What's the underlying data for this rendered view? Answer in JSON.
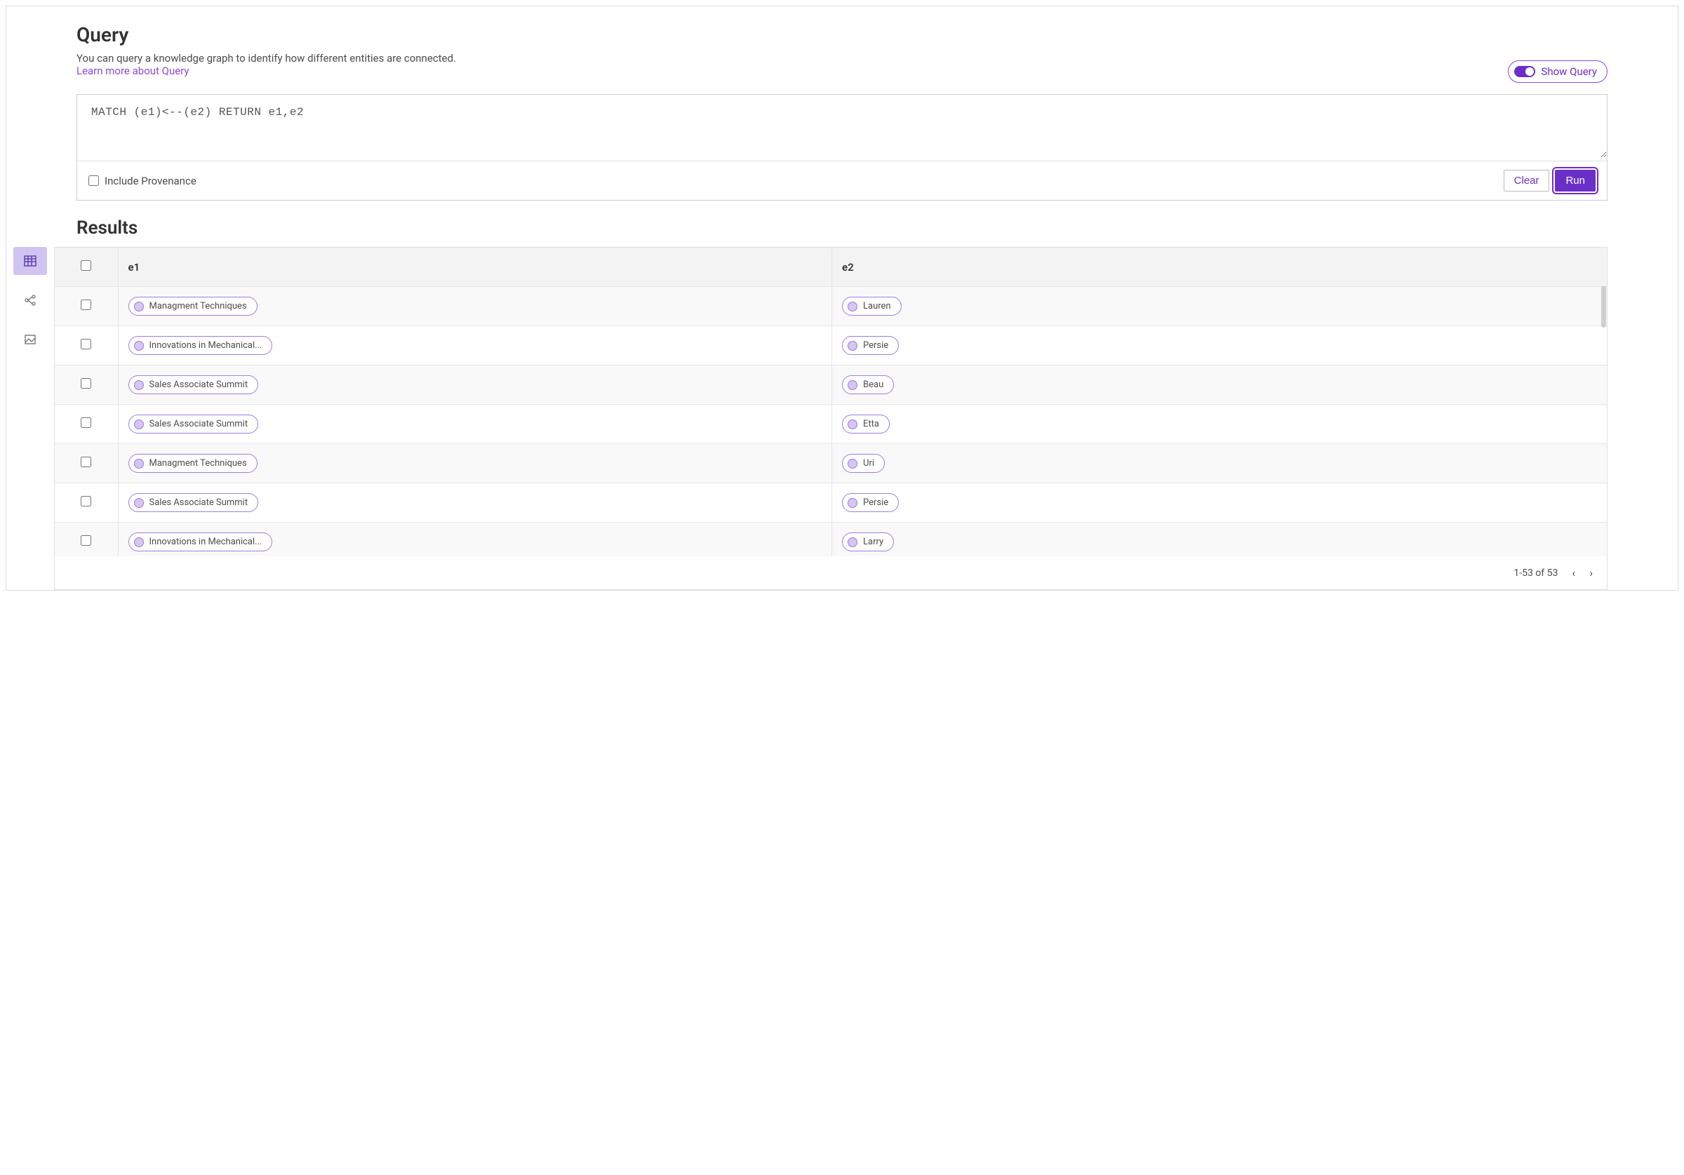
{
  "query": {
    "title": "Query",
    "description": "You can query a knowledge graph to identify how different entities are connected.",
    "learn_more": "Learn more about Query",
    "toggle_label": "Show Query",
    "text": "MATCH (e1)<--(e2) RETURN e1,e2",
    "include_provenance_label": "Include Provenance",
    "clear_label": "Clear",
    "run_label": "Run"
  },
  "results": {
    "title": "Results",
    "columns": {
      "e1": "e1",
      "e2": "e2"
    },
    "rows": [
      {
        "e1": "Managment Techniques",
        "e2": "Lauren"
      },
      {
        "e1": "Innovations in Mechanical...",
        "e2": "Persie"
      },
      {
        "e1": "Sales Associate Summit",
        "e2": "Beau"
      },
      {
        "e1": "Sales Associate Summit",
        "e2": "Etta"
      },
      {
        "e1": "Managment Techniques",
        "e2": "Uri"
      },
      {
        "e1": "Sales Associate Summit",
        "e2": "Persie"
      },
      {
        "e1": "Innovations in Mechanical...",
        "e2": "Larry"
      }
    ],
    "footer": "1-53 of 53"
  },
  "sidebar": {
    "table_icon": "table-view",
    "graph_icon": "graph-view",
    "image_icon": "image-view"
  }
}
